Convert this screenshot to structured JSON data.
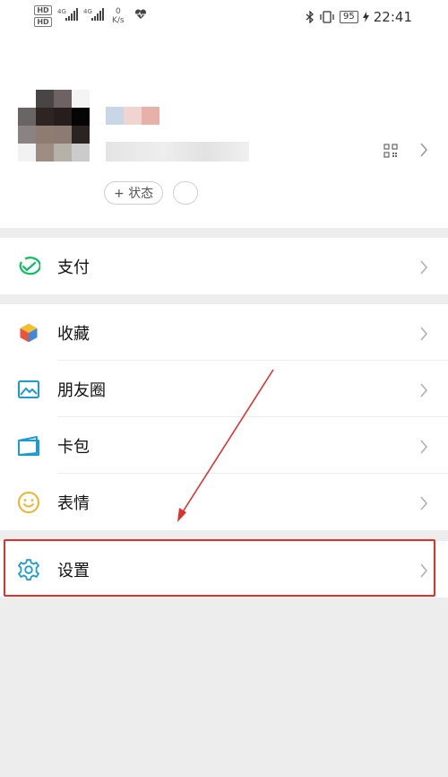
{
  "status_bar": {
    "hd1": "HD",
    "hd2": "HD",
    "net1": "4G",
    "net2": "4G",
    "speed_value": "0",
    "speed_unit": "K/s",
    "battery": "95",
    "time": "22:41"
  },
  "profile": {
    "status_label": "+ 状态"
  },
  "menu": {
    "pay": "支付",
    "favorites": "收藏",
    "moments": "朋友圈",
    "cards": "卡包",
    "stickers": "表情",
    "settings": "设置"
  },
  "colors": {
    "green": "#07c160",
    "blue": "#1a9bd4",
    "highlight": "#e0302a"
  }
}
